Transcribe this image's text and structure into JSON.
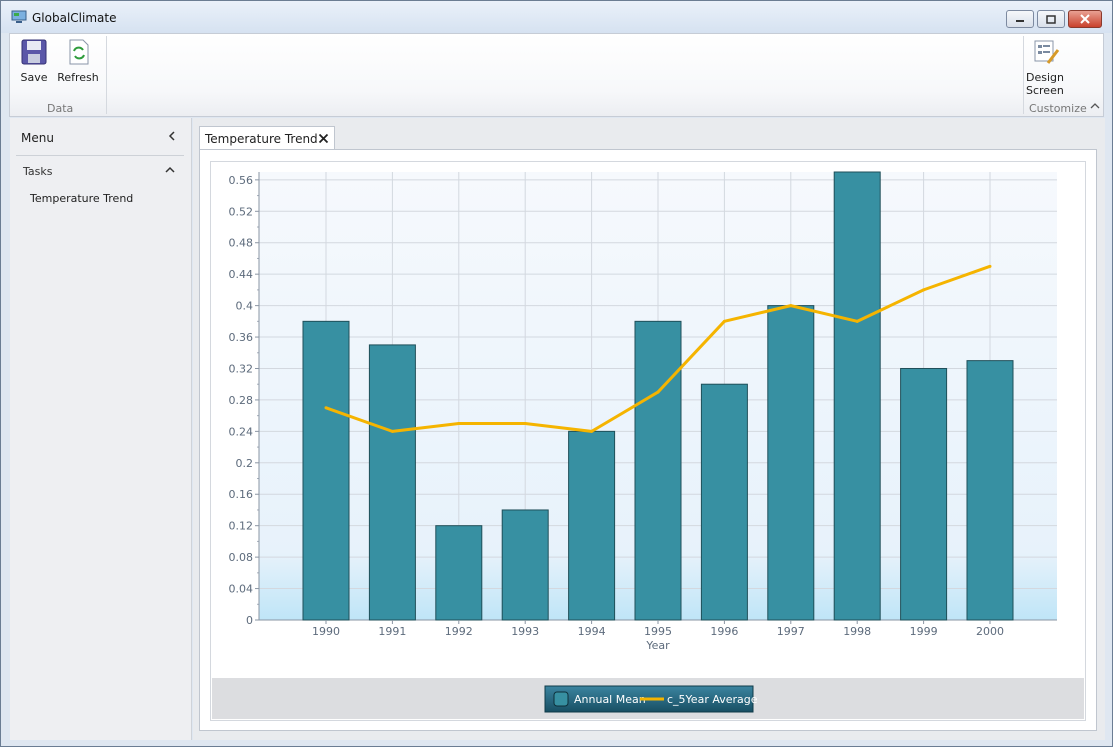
{
  "window": {
    "title": "GlobalClimate"
  },
  "ribbon": {
    "save_label": "Save",
    "refresh_label": "Refresh",
    "data_group_label": "Data",
    "design_label_line1": "Design",
    "design_label_line2": "Screen",
    "customize_group_label": "Customize"
  },
  "menu": {
    "title": "Menu",
    "tasks_label": "Tasks",
    "items": [
      {
        "label": "Temperature Trend"
      }
    ]
  },
  "tabs": [
    {
      "label": "Temperature Trend"
    }
  ],
  "colors": {
    "bar": "#3790a2",
    "bar_stroke": "#1f4f59",
    "line": "#f5b400",
    "legend_bg": "#1f5f74"
  },
  "chart_data": {
    "type": "bar",
    "categories": [
      "1990",
      "1991",
      "1992",
      "1993",
      "1994",
      "1995",
      "1996",
      "1997",
      "1998",
      "1999",
      "2000"
    ],
    "series": [
      {
        "name": "Annual Mean",
        "type": "bar",
        "values": [
          0.38,
          0.35,
          0.12,
          0.14,
          0.24,
          0.38,
          0.3,
          0.4,
          0.57,
          0.32,
          0.33
        ]
      },
      {
        "name": "c_5Year Average",
        "type": "line",
        "values": [
          0.27,
          0.24,
          0.25,
          0.25,
          0.24,
          0.29,
          0.38,
          0.4,
          0.38,
          0.42,
          0.45
        ]
      }
    ],
    "xlabel": "Year",
    "ylabel": "",
    "ylim": [
      0,
      0.57
    ],
    "yticks": [
      "0",
      "0.04",
      "0.08",
      "0.12",
      "0.16",
      "0.2",
      "0.24",
      "0.28",
      "0.32",
      "0.36",
      "0.4",
      "0.44",
      "0.48",
      "0.52",
      "0.56"
    ],
    "grid": true,
    "legend_position": "bottom"
  }
}
